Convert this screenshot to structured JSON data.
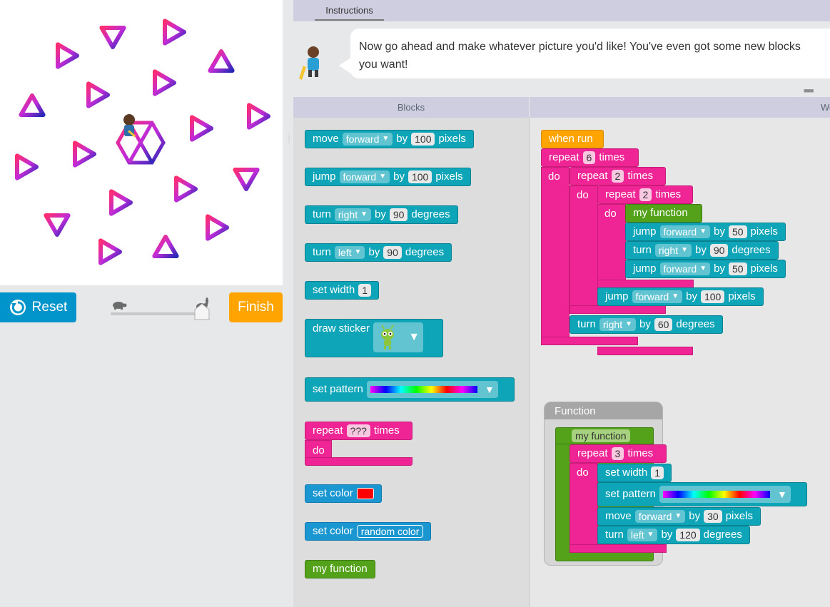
{
  "instructions": {
    "tab_label": "Instructions",
    "line1": "Now go ahead and make whatever picture you'd like! You've even got some new blocks",
    "line2": "you want!"
  },
  "controls": {
    "reset_label": "Reset",
    "finish_label": "Finish",
    "speed_level": 1.0
  },
  "toolbox": {
    "header": "Blocks",
    "blocks": [
      {
        "label": "move",
        "dropdown": "forward",
        "mid": "by",
        "value": "100",
        "suffix": "pixels"
      },
      {
        "label": "jump",
        "dropdown": "forward",
        "mid": "by",
        "value": "100",
        "suffix": "pixels"
      },
      {
        "label": "turn",
        "dropdown": "right",
        "mid": "by",
        "value": "90",
        "suffix": "degrees"
      },
      {
        "label": "turn",
        "dropdown": "left",
        "mid": "by",
        "value": "90",
        "suffix": "degrees"
      },
      {
        "label": "set width",
        "value": "1"
      },
      {
        "label": "draw sticker"
      },
      {
        "label": "set pattern"
      },
      {
        "label": "repeat",
        "value": "???",
        "suffix": "times",
        "do": "do"
      },
      {
        "label": "set color"
      },
      {
        "label": "set color",
        "value": "random color"
      },
      {
        "label": "my function"
      }
    ]
  },
  "workspace": {
    "header": "Wo",
    "main": {
      "when_run": "when run",
      "repeat_outer": {
        "label": "repeat",
        "value": "6",
        "suffix": "times",
        "do": "do"
      },
      "repeat_mid": {
        "label": "repeat",
        "value": "2",
        "suffix": "times",
        "do": "do"
      },
      "repeat_inner": {
        "label": "repeat",
        "value": "2",
        "suffix": "times",
        "do": "do"
      },
      "call": "my function",
      "jump1": {
        "label": "jump",
        "dropdown": "forward",
        "mid": "by",
        "value": "50",
        "suffix": "pixels"
      },
      "turn1": {
        "label": "turn",
        "dropdown": "right",
        "mid": "by",
        "value": "90",
        "suffix": "degrees"
      },
      "jump2": {
        "label": "jump",
        "dropdown": "forward",
        "mid": "by",
        "value": "50",
        "suffix": "pixels"
      },
      "jump3": {
        "label": "jump",
        "dropdown": "forward",
        "mid": "by",
        "value": "100",
        "suffix": "pixels"
      },
      "turn2": {
        "label": "turn",
        "dropdown": "right",
        "mid": "by",
        "value": "60",
        "suffix": "degrees"
      }
    },
    "function": {
      "title": "Function",
      "name": "my function",
      "repeat": {
        "label": "repeat",
        "value": "3",
        "suffix": "times",
        "do": "do"
      },
      "set_width": {
        "label": "set width",
        "value": "1"
      },
      "set_pattern": {
        "label": "set pattern"
      },
      "move": {
        "label": "move",
        "dropdown": "forward",
        "mid": "by",
        "value": "30",
        "suffix": "pixels"
      },
      "turn": {
        "label": "turn",
        "dropdown": "left",
        "mid": "by",
        "value": "120",
        "suffix": "degrees"
      }
    }
  },
  "colors": {
    "teal": "#0fa5b8",
    "blue": "#1a96d1",
    "pink": "#ef2595",
    "green": "#53a21a",
    "orange": "#ffa400",
    "set_color_swatch": "#ff0000"
  }
}
